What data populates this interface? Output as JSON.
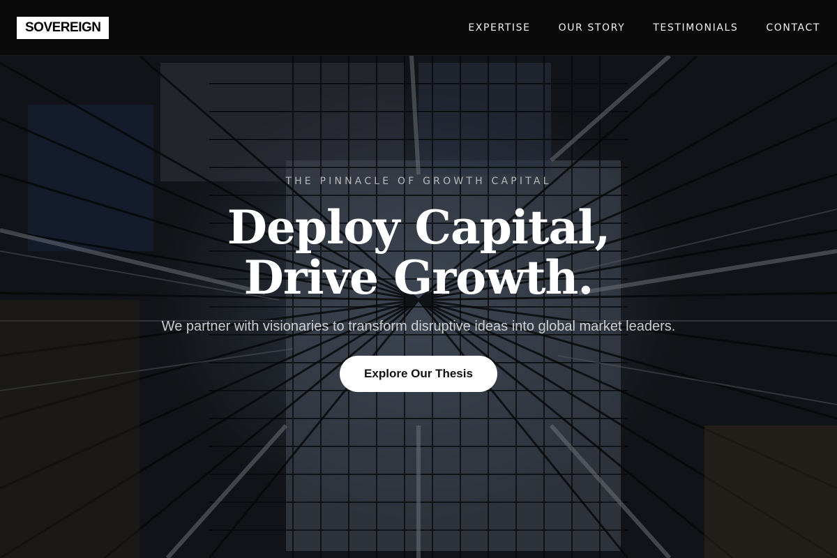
{
  "header": {
    "logo": "SOVEREIGN",
    "nav": [
      {
        "label": "EXPERTISE"
      },
      {
        "label": "OUR STORY"
      },
      {
        "label": "TESTIMONIALS"
      },
      {
        "label": "CONTACT"
      }
    ]
  },
  "hero": {
    "eyebrow": "THE PINNACLE OF GROWTH CAPITAL",
    "headline_line1": "Deploy Capital,",
    "headline_line2": "Drive Growth.",
    "subtitle": "We partner with visionaries to transform disruptive ideas into global market leaders.",
    "cta_label": "Explore Our Thesis"
  },
  "colors": {
    "header_bg": "#0a0a0a",
    "logo_bg": "#ffffff",
    "text_primary": "#ffffff",
    "cta_bg": "#ffffff",
    "cta_text": "#111111"
  }
}
